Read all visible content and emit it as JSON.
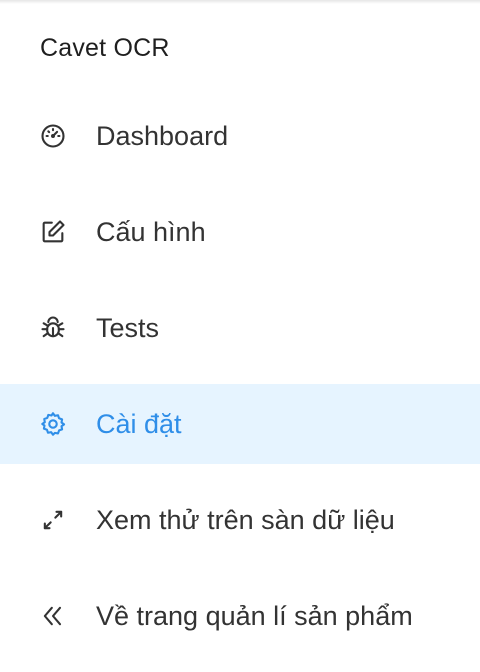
{
  "app": {
    "title": "Cavet OCR"
  },
  "menu": {
    "items": [
      {
        "label": "Dashboard",
        "icon": "dashboard-icon",
        "active": false
      },
      {
        "label": "Cấu hình",
        "icon": "edit-icon",
        "active": false
      },
      {
        "label": "Tests",
        "icon": "bug-icon",
        "active": false
      },
      {
        "label": "Cài đặt",
        "icon": "settings-icon",
        "active": true
      },
      {
        "label": "Xem thử trên sàn dữ liệu",
        "icon": "expand-icon",
        "active": false
      },
      {
        "label": "Về trang quản lí sản phẩm",
        "icon": "double-chevron-left-icon",
        "active": false
      }
    ]
  },
  "colors": {
    "active_text": "#2f8ee8",
    "active_background": "#e6f4ff",
    "text": "#333333"
  }
}
